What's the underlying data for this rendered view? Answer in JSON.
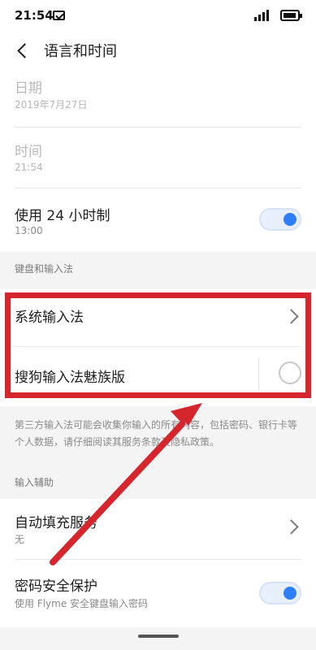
{
  "status_bar": {
    "time": "21:54"
  },
  "header": {
    "title": "语言和时间"
  },
  "settings": {
    "date": {
      "title": "日期",
      "value": "2019年7月27日"
    },
    "time": {
      "title": "时间",
      "value": "21:54"
    },
    "hour24": {
      "title": "使用 24 小时制",
      "value": "13:00",
      "enabled": true
    }
  },
  "keyboard_section": {
    "header": "键盘和输入法",
    "system_input": "系统输入法",
    "sogou_input": "搜狗输入法魅族版",
    "notice": "第三方输入法可能会收集你输入的所有内容，包括密码、银行卡等个人数据，请仔细阅读其服务条款及隐私政策。"
  },
  "input_assist_section": {
    "header": "输入辅助",
    "autofill": {
      "title": "自动填充服务",
      "value": "无"
    },
    "password_protection": {
      "title": "密码安全保护",
      "value": "使用 Flyme 安全键盘输入密码",
      "enabled": true
    }
  },
  "colors": {
    "accent": "#2d7ef7",
    "highlight": "#d6262d",
    "background": "#f4f4f4"
  },
  "icons": {
    "back": "back-icon",
    "chevron": "chevron-right-icon",
    "mail": "mail-icon",
    "signal": "signal-icon",
    "battery": "battery-icon"
  }
}
